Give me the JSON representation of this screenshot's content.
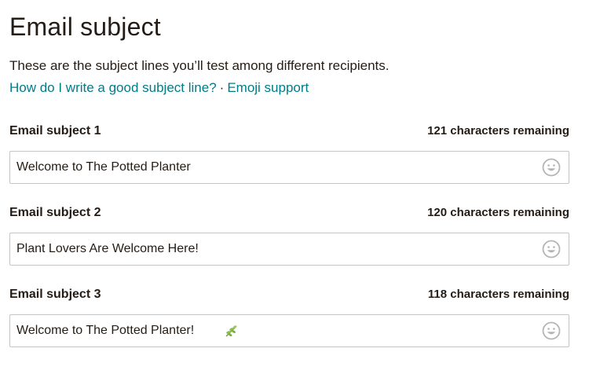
{
  "header": {
    "title": "Email subject",
    "description": "These are the subject lines you’ll test among different recipients.",
    "help_link": "How do I write a good subject line?",
    "separator": "·",
    "emoji_link": "Emoji support"
  },
  "fields": [
    {
      "label": "Email subject 1",
      "remaining": "121 characters remaining",
      "value": "Welcome to The Potted Planter"
    },
    {
      "label": "Email subject 2",
      "remaining": "120 characters remaining",
      "value": "Plant Lovers Are Welcome Here!"
    },
    {
      "label": "Email subject 3",
      "remaining": "118 characters remaining",
      "value": "Welcome to The Potted Planter!",
      "trailing_emoji": "herb-emoji"
    }
  ],
  "icons": {
    "emoji_button": "smiley-face-icon"
  },
  "colors": {
    "link": "#007c89",
    "text": "#241c15",
    "border": "#c5c5c5",
    "icon": "#b5b5b5"
  }
}
